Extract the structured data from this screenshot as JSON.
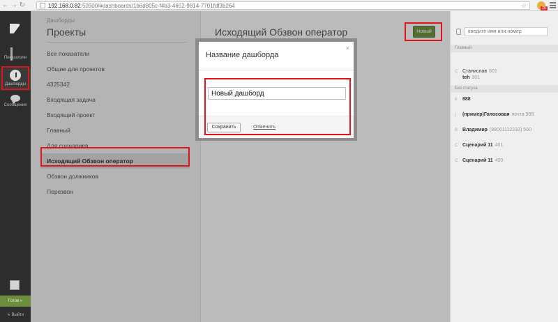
{
  "browser": {
    "url_host": "192.168.0.82",
    "url_rest": ":50500/#dashboards/1b6d805c-f4b3-4652-9814-7701fdf3b264",
    "badge": "20"
  },
  "rail": {
    "items": [
      {
        "label": "Показатели",
        "icon": "bar-chart-icon"
      },
      {
        "label": "Дашборды",
        "icon": "dashboard-gauge-icon"
      },
      {
        "label": "Сообщения",
        "icon": "chat-bubble-icon"
      }
    ],
    "ready_label": "Готов »",
    "exit_label": "Выйти"
  },
  "list": {
    "breadcrumb": "Дашборды",
    "title": "Проекты",
    "items": [
      "Все показатели",
      "Общие для проектов",
      "4325342",
      "Входящая задача",
      "Входящий проект",
      "Главный",
      "Для сценариев",
      "Исходящий Обзвон оператор",
      "Обзвон должников",
      "Перезвон"
    ],
    "active_index": 7
  },
  "main": {
    "dashboard_title": "Исходящий Обзвон оператор",
    "new_button": "Новый"
  },
  "right": {
    "search_placeholder": "введите имя или номер",
    "sections": [
      {
        "title": "Главный",
        "contacts": [
          {
            "marker": "·",
            "name": "teh",
            "ext": "301"
          },
          {
            "marker": "С",
            "name": "Станислав",
            "ext": "601"
          }
        ]
      },
      {
        "title": "Без статуса",
        "contacts": [
          {
            "marker": "8",
            "name": "888",
            "ext": ""
          },
          {
            "marker": "(",
            "name": "(пример)Голосовая",
            "ext": "почта 999"
          },
          {
            "marker": "В",
            "name": "Владимир",
            "ext": "(88001112233) 500"
          },
          {
            "marker": "С",
            "name": "Сценарий 11",
            "ext": "401"
          },
          {
            "marker": "С",
            "name": "Сценарий 11",
            "ext": "400"
          }
        ]
      }
    ]
  },
  "modal": {
    "title": "Название дашборда",
    "close": "×",
    "input_value": "Новый дашборд",
    "save_label": "Сохранить",
    "cancel_label": "Отменить"
  }
}
